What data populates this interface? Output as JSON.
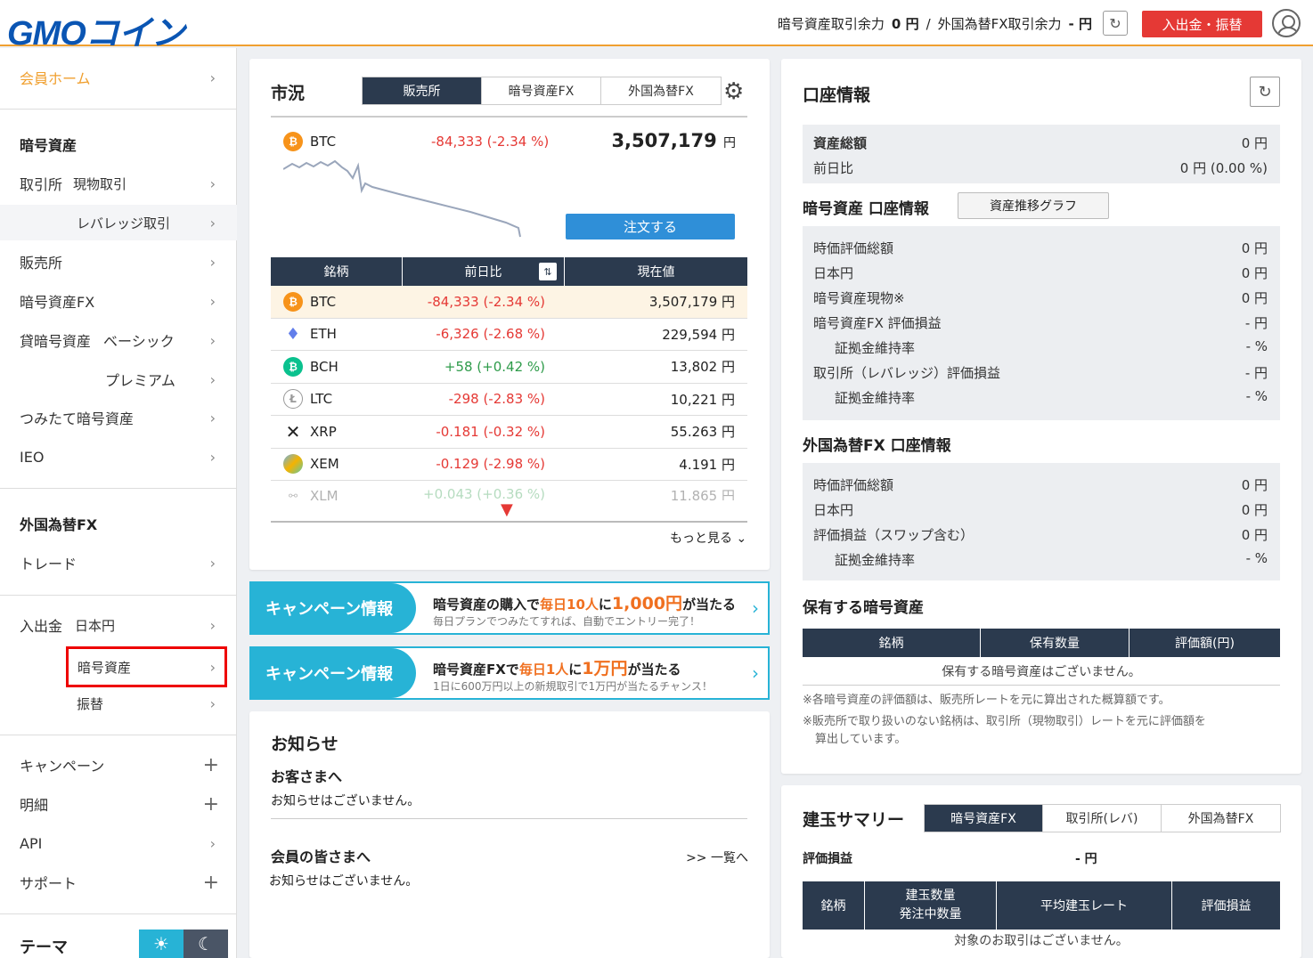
{
  "header": {
    "logo": "GMOコイン",
    "crypto_margin_label": "暗号資産取引余力",
    "crypto_margin_value": "0 円",
    "separator": "/",
    "fx_margin_label": "外国為替FX取引余力",
    "fx_margin_value": "- 円",
    "deposit_button": "入出金・振替"
  },
  "sidebar": {
    "home": "会員ホーム",
    "crypto_section": "暗号資産",
    "exchange": "取引所",
    "exchange_spot": "現物取引",
    "exchange_leverage": "レバレッジ取引",
    "store": "販売所",
    "crypto_fx": "暗号資産FX",
    "lending": "貸暗号資産",
    "lending_basic": "ベーシック",
    "lending_premium": "プレミアム",
    "tsumitate": "つみたて暗号資産",
    "ieo": "IEO",
    "fx_section": "外国為替FX",
    "trade": "トレード",
    "deposit": "入出金",
    "deposit_jpy": "日本円",
    "deposit_crypto": "暗号資産",
    "transfer": "振替",
    "campaign": "キャンペーン",
    "statement": "明細",
    "api": "API",
    "support": "サポート",
    "theme": "テーマ"
  },
  "market": {
    "title": "市況",
    "tabs": [
      "販売所",
      "暗号資産FX",
      "外国為替FX"
    ],
    "featured": {
      "symbol": "BTC",
      "change": "-84,333 (-2.34 %)",
      "price": "3,507,179",
      "unit": "円"
    },
    "order_button": "注文する",
    "columns": [
      "銘柄",
      "前日比",
      "現在値"
    ],
    "rows": [
      {
        "symbol": "BTC",
        "change": "-84,333 (-2.34 %)",
        "price": "3,507,179 円"
      },
      {
        "symbol": "ETH",
        "change": "-6,326 (-2.68 %)",
        "price": "229,594 円"
      },
      {
        "symbol": "BCH",
        "change": "+58 (+0.42 %)",
        "price": "13,802 円"
      },
      {
        "symbol": "LTC",
        "change": "-298 (-2.83 %)",
        "price": "10,221 円"
      },
      {
        "symbol": "XRP",
        "change": "-0.181 (-0.32 %)",
        "price": "55.263 円"
      },
      {
        "symbol": "XEM",
        "change": "-0.129 (-2.98 %)",
        "price": "4.191 円"
      },
      {
        "symbol": "XLM",
        "change": "+0.043 (+0.36 %)",
        "price": "11.865 円"
      }
    ],
    "more": "もっと見る"
  },
  "campaigns": [
    {
      "label": "キャンペーン情報",
      "pre": "暗号資産の購入で",
      "hl1": "毎日10人",
      "mid": "に",
      "hl2": "1,000円",
      "post": "が当たる",
      "sub": "毎日プランでつみたてすれば、自動でエントリー完了！"
    },
    {
      "label": "キャンペーン情報",
      "pre": "暗号資産FXで",
      "hl1": "毎日1人",
      "mid": "に",
      "hl2": "1万円",
      "post": "が当たる",
      "sub": "1日に600万円以上の新規取引で1万円が当たるチャンス！"
    }
  ],
  "news": {
    "title": "お知らせ",
    "customer_head": "お客さまへ",
    "customer_body": "お知らせはございません。",
    "members_head": "会員の皆さまへ",
    "members_link": ">> 一覧へ",
    "members_body": "お知らせはございません。"
  },
  "account": {
    "title": "口座情報",
    "total_label": "資産総額",
    "total_value": "0 円",
    "prev_label": "前日比",
    "prev_value": "0 円 (0.00 %)",
    "crypto_title": "暗号資産 口座情報",
    "graph_button": "資産推移グラフ",
    "crypto_rows": [
      {
        "label": "時価評価総額",
        "value": "0 円"
      },
      {
        "label": "日本円",
        "value": "0 円"
      },
      {
        "label": "暗号資産現物※",
        "value": "0 円"
      },
      {
        "label": "暗号資産FX 評価損益",
        "value": "- 円"
      },
      {
        "label": "証拠金維持率",
        "value": "- %"
      },
      {
        "label": "取引所（レバレッジ）評価損益",
        "value": "- 円"
      },
      {
        "label": "証拠金維持率",
        "value": "- %"
      }
    ],
    "fx_title": "外国為替FX 口座情報",
    "fx_rows": [
      {
        "label": "時価評価総額",
        "value": "0 円"
      },
      {
        "label": "日本円",
        "value": "0 円"
      },
      {
        "label": "評価損益（スワップ含む）",
        "value": "0 円"
      },
      {
        "label": "証拠金維持率",
        "value": "- %"
      }
    ],
    "holdings_title": "保有する暗号資産",
    "holdings_cols": [
      "銘柄",
      "保有数量",
      "評価額(円)"
    ],
    "holdings_empty": "保有する暗号資産はございません。",
    "note1": "※各暗号資産の評価額は、販売所レートを元に算出された概算額です。",
    "note2": "※販売所で取り扱いのない銘柄は、取引所（現物取引）レートを元に評価額を",
    "note3": "算出しています。"
  },
  "positions": {
    "title": "建玉サマリー",
    "tabs": [
      "暗号資産FX",
      "取引所(レバ)",
      "外国為替FX"
    ],
    "pl_label": "評価損益",
    "pl_value": "- 円",
    "cols": [
      "銘柄",
      "建玉数量",
      "発注中数量",
      "平均建玉レート",
      "評価損益"
    ],
    "empty": "対象のお取引はございません。"
  }
}
